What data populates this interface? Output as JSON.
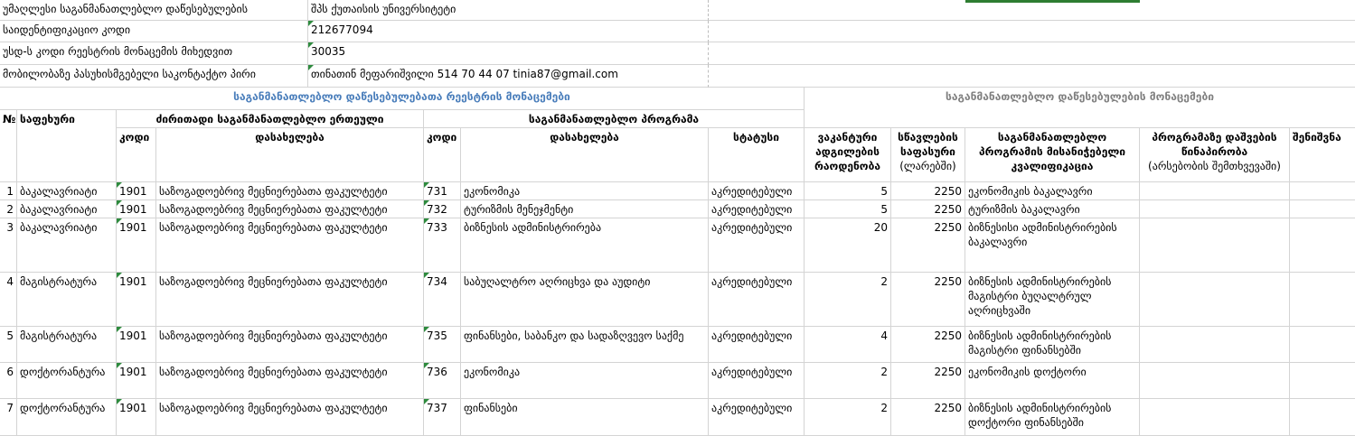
{
  "info": [
    {
      "label": "უმაღლესი საგანმანათლებლო დაწესებულების",
      "value": "შპს ქუთაისის უნივერსიტეტი"
    },
    {
      "label": "საიდენტიფიკაციო კოდი",
      "value": "212677094"
    },
    {
      "label": "უსდ-ს კოდი რეესტრის მონაცემის მიხედვით",
      "value": "30035"
    },
    {
      "label": "მობილობაზე პასუხისმგებელი საკონტაქტო პირი",
      "value": "თინათინ მეფარიშვილი    514 70 44 07    tinia87@gmail.com"
    }
  ],
  "headers": {
    "registry_title": "საგანმანათლებლო დაწესებულებათა რეესტრის მონაცემები",
    "institution_title": "საგანმანათლებლო დაწესებულების მონაცემები",
    "num": "№",
    "level": "საფეხური",
    "main_unit": "ძირითადი საგანმანათლებლო ერთეული",
    "program": "საგანმანათლებლო პროგრამა",
    "code": "კოდი",
    "name": "დასახელება",
    "status": "სტატუსი",
    "vacant": "ვაკანტური ადგილების რაოდენობა",
    "tuition": "სწავლების საფასური",
    "tuition_unit": "(ლარებში)",
    "qualification": "საგანმანათლებლო პროგრამის მისანიჭებელი კვალიფიკაცია",
    "prereq": "პროგრამაზე დაშვების წინაპირობა",
    "prereq_note": "(არსებობის შემთხვევაში)",
    "notes": "შენიშვნა"
  },
  "rows": [
    {
      "n": "1",
      "level": "ბაკალავრიატი",
      "unit_code": "1901",
      "unit_name": "საზოგადოებრივ მეცნიერებათა ფაკულტეტი",
      "prog_code": "731",
      "prog_name": "ეკონომიკა",
      "status": "აკრედიტებული",
      "vacant": "5",
      "fee": "2250",
      "qual": "ეკონომიკის ბაკალავრი"
    },
    {
      "n": "2",
      "level": "ბაკალავრიატი",
      "unit_code": "1901",
      "unit_name": "საზოგადოებრივ მეცნიერებათა ფაკულტეტი",
      "prog_code": "732",
      "prog_name": "ტურიზმის მენეჯმენტი",
      "status": "აკრედიტებული",
      "vacant": "5",
      "fee": "2250",
      "qual": "ტურიზმის ბაკალავრი"
    },
    {
      "n": "3",
      "level": "ბაკალავრიატი",
      "unit_code": "1901",
      "unit_name": "საზოგადოებრივ მეცნიერებათა ფაკულტეტი",
      "prog_code": "733",
      "prog_name": "ბიზნესის ადმინისტრირება",
      "status": "აკრედიტებული",
      "vacant": "20",
      "fee": "2250",
      "qual": "ბიზნესისი ადმინისტრირების ბაკალავრი"
    },
    {
      "n": "4",
      "level": "მაგისტრატურა",
      "unit_code": "1901",
      "unit_name": "საზოგადოებრივ მეცნიერებათა ფაკულტეტი",
      "prog_code": "734",
      "prog_name": "საბუღალტრო აღრიცხვა და აუდიტი",
      "status": "აკრედიტებული",
      "vacant": "2",
      "fee": "2250",
      "qual": "ბიზნესის ადმინისტრირების მაგისტრი ბუღალტრულ აღრიცხვაში"
    },
    {
      "n": "5",
      "level": "მაგისტრატურა",
      "unit_code": "1901",
      "unit_name": "საზოგადოებრივ მეცნიერებათა ფაკულტეტი",
      "prog_code": "735",
      "prog_name": "ფინანსები, საბანკო და სადაზღვევო საქმე",
      "status": "აკრედიტებული",
      "vacant": "4",
      "fee": "2250",
      "qual": "ბიზნესის ადმინისტრირების მაგისტრი  ფინანსებში"
    },
    {
      "n": "6",
      "level": "დოქტორანტურა",
      "unit_code": "1901",
      "unit_name": "საზოგადოებრივ მეცნიერებათა ფაკულტეტი",
      "prog_code": "736",
      "prog_name": "ეკონომიკა",
      "status": "აკრედიტებული",
      "vacant": "2",
      "fee": "2250",
      "qual": "ეკონომიკის დოქტორი"
    },
    {
      "n": "7",
      "level": "დოქტორანტურა",
      "unit_code": "1901",
      "unit_name": "საზოგადოებრივ მეცნიერებათა ფაკულტეტი",
      "prog_code": "737",
      "prog_name": "ფინანსები",
      "status": "აკრედიტებული",
      "vacant": "2",
      "fee": "2250",
      "qual": "ბიზნესის ადმინისტრირების დოქტორი ფინანსებში"
    }
  ]
}
